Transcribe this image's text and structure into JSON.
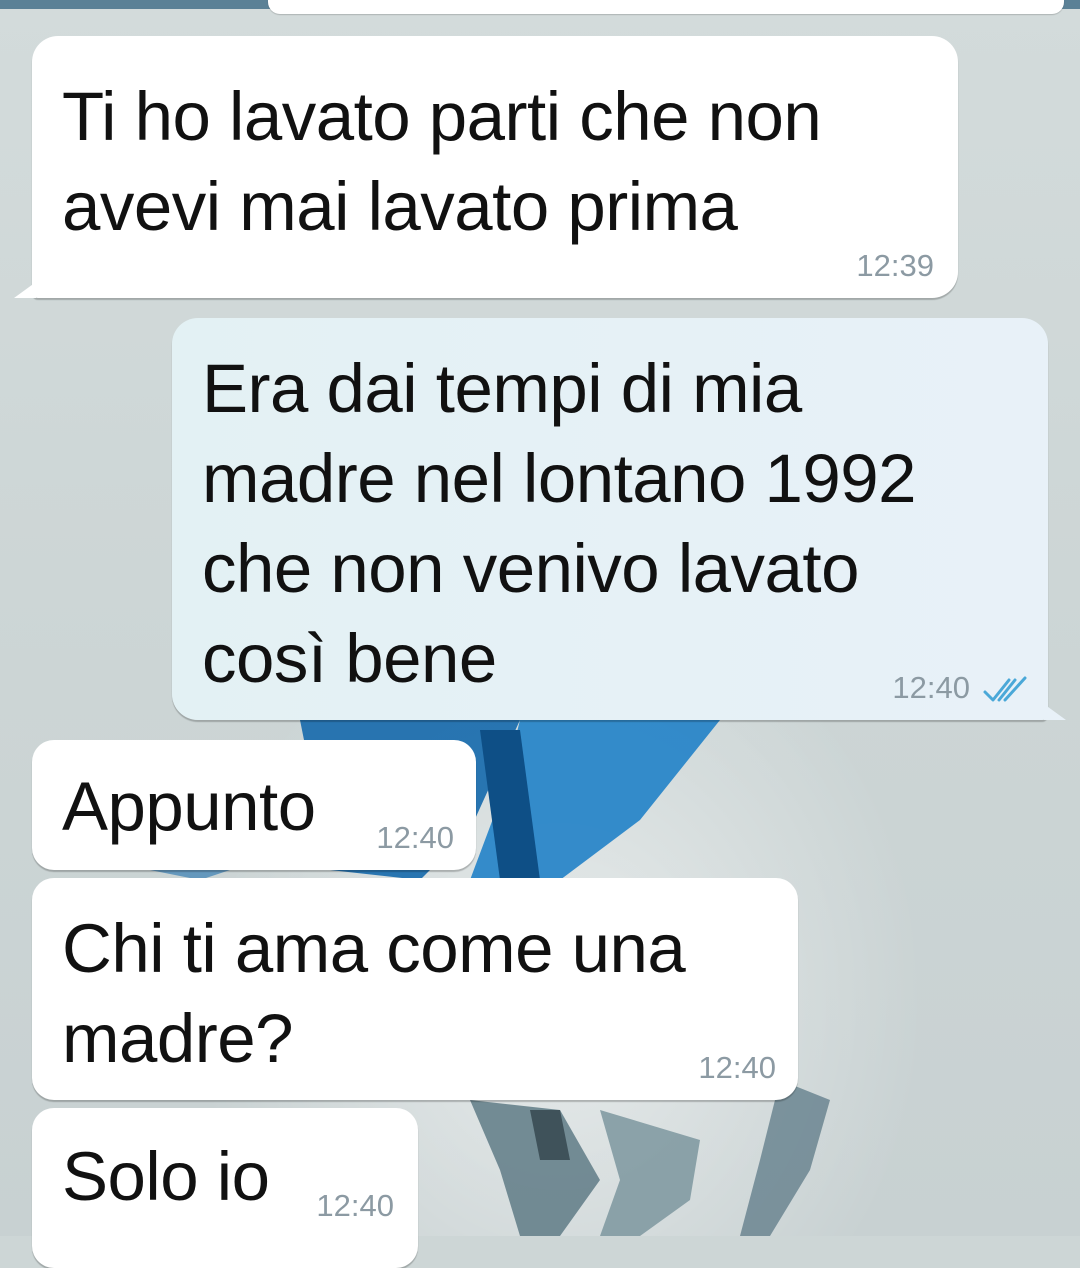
{
  "messages": [
    {
      "direction": "incoming",
      "text": "Ti ho lavato parti che non\navevi mai lavato prima",
      "time": "12:39"
    },
    {
      "direction": "outgoing",
      "text": "Era dai tempi di mia\nmadre nel lontano 1992\nche non venivo lavato\ncosì bene",
      "time": "12:40",
      "status_icon": "double-check-icon"
    },
    {
      "direction": "incoming",
      "text": "Appunto",
      "time": "12:40"
    },
    {
      "direction": "incoming",
      "text": "Chi ti ama come una\nmadre?",
      "time": "12:40"
    },
    {
      "direction": "incoming",
      "text": "Solo io",
      "time": "12:40"
    }
  ],
  "colors": {
    "incoming_bubble": "#ffffff",
    "outgoing_bubble": "#e6f1f6",
    "timestamp": "#8c9aa3",
    "read_ticks": "#4aa8d8",
    "background": "#cdd6d6"
  }
}
